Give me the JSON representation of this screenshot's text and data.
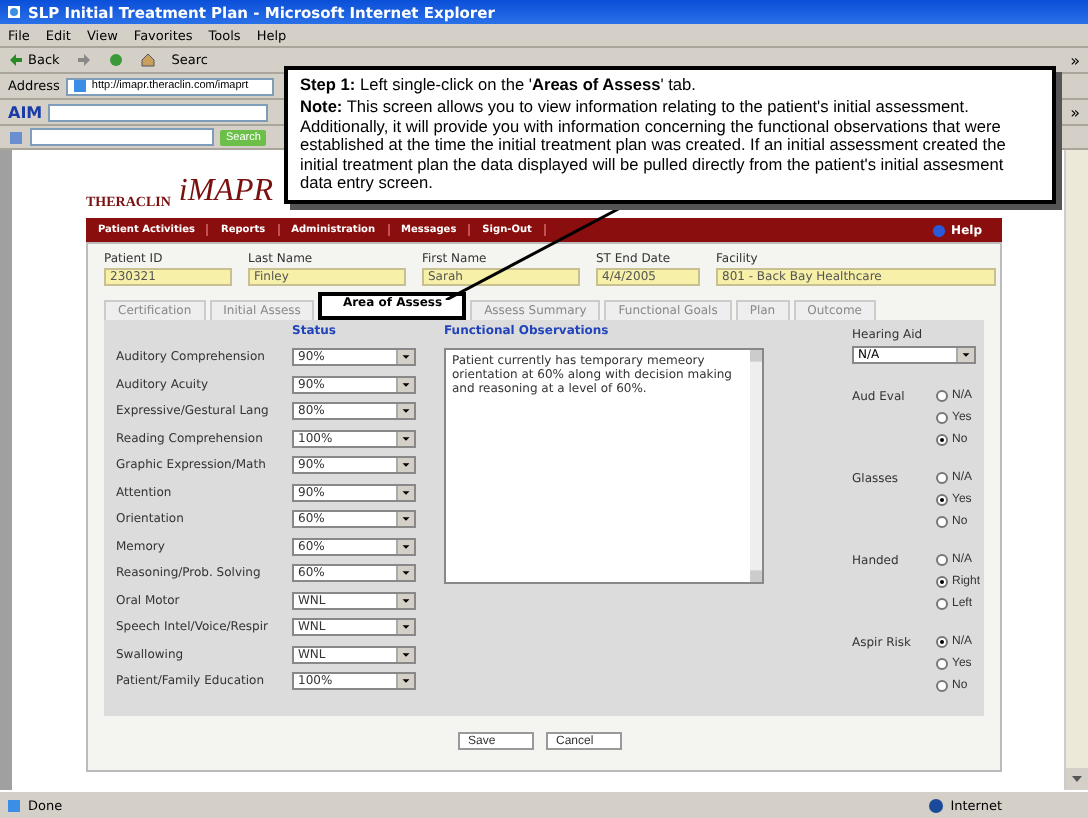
{
  "window": {
    "title": "SLP Initial Treatment Plan - Microsoft Internet Explorer"
  },
  "menu": [
    "File",
    "Edit",
    "View",
    "Favorites",
    "Tools",
    "Help"
  ],
  "toolbar": {
    "back": "Back",
    "search": "Searc",
    "chevron": "»"
  },
  "address": {
    "label": "Address",
    "url": "http://imapr.theraclin.com/imaprt"
  },
  "aim_bar": {
    "label": "AIM",
    "chevron": "»"
  },
  "search_bar": {
    "button": "Search"
  },
  "logo": {
    "brand": "THERACLIN",
    "product": "iMAPR"
  },
  "callout": {
    "step": "**Step 1:** Left single-click on the '**Areas of Assess**' tab.",
    "note": "**Note:** This screen allows you to view information relating to the patient's initial assessment. Additionally, it will provide you with information concerning the functional observations that were established at the time the initial treatment plan was created. If an initial assessment created the initial treatment plan the data displayed will be pulled directly from the patient's initial assesment data entry screen."
  },
  "nav": {
    "items": [
      "Patient Activities",
      "Reports",
      "Administration",
      "Messages",
      "Sign-Out"
    ],
    "help": "Help"
  },
  "patient": [
    {
      "label": "Patient ID",
      "value": "230321"
    },
    {
      "label": "Last Name",
      "value": "Finley"
    },
    {
      "label": "First Name",
      "value": "Sarah"
    },
    {
      "label": "ST End Date",
      "value": "4/4/2005"
    },
    {
      "label": "Facility",
      "value": "801 - Back Bay Healthcare"
    }
  ],
  "tabs": [
    {
      "label": "Certification",
      "selected": false
    },
    {
      "label": "Initial Assess",
      "selected": false
    },
    {
      "label": "Area of Assess",
      "selected": true
    },
    {
      "label": "Assess Summary",
      "selected": false
    },
    {
      "label": "Functional Goals",
      "selected": false
    },
    {
      "label": "Plan",
      "selected": false
    },
    {
      "label": "Outcome",
      "selected": false
    }
  ],
  "status_header": "Status",
  "observations_header": "Functional Observations",
  "areas": [
    {
      "label": "Auditory Comprehension",
      "value": "90%"
    },
    {
      "label": "Auditory Acuity",
      "value": "90%"
    },
    {
      "label": "Expressive/Gestural Lang",
      "value": "80%"
    },
    {
      "label": "Reading Comprehension",
      "value": "100%"
    },
    {
      "label": "Graphic Expression/Math",
      "value": "90%"
    },
    {
      "label": "Attention",
      "value": "90%"
    },
    {
      "label": "Orientation",
      "value": "60%"
    },
    {
      "label": "Memory",
      "value": "60%"
    },
    {
      "label": "Reasoning/Prob. Solving",
      "value": "60%"
    },
    {
      "label": "Oral Motor",
      "value": "WNL"
    },
    {
      "label": "Speech Intel/Voice/Respir",
      "value": "WNL"
    },
    {
      "label": "Swallowing",
      "value": "WNL"
    },
    {
      "label": "Patient/Family Education",
      "value": "100%"
    }
  ],
  "observations": "Patient currently has temporary memeory orientation at 60% along with decision making and reasoning at a level of 60%.",
  "hearing_aid": {
    "label": "Hearing Aid",
    "value": "N/A"
  },
  "radio_groups": [
    {
      "label": "Aud Eval",
      "options": [
        {
          "label": "N/A",
          "selected": false
        },
        {
          "label": "Yes",
          "selected": false
        },
        {
          "label": "No",
          "selected": true
        }
      ]
    },
    {
      "label": "Glasses",
      "options": [
        {
          "label": "N/A",
          "selected": false
        },
        {
          "label": "Yes",
          "selected": true
        },
        {
          "label": "No",
          "selected": false
        }
      ]
    },
    {
      "label": "Handed",
      "options": [
        {
          "label": "N/A",
          "selected": false
        },
        {
          "label": "Right",
          "selected": true
        },
        {
          "label": "Left",
          "selected": false
        }
      ]
    },
    {
      "label": "Aspir Risk",
      "options": [
        {
          "label": "N/A",
          "selected": true
        },
        {
          "label": "Yes",
          "selected": false
        },
        {
          "label": "No",
          "selected": false
        }
      ]
    }
  ],
  "buttons": [
    "Save",
    "Cancel"
  ],
  "status_bar": {
    "text": "Done",
    "zone": "Internet"
  }
}
